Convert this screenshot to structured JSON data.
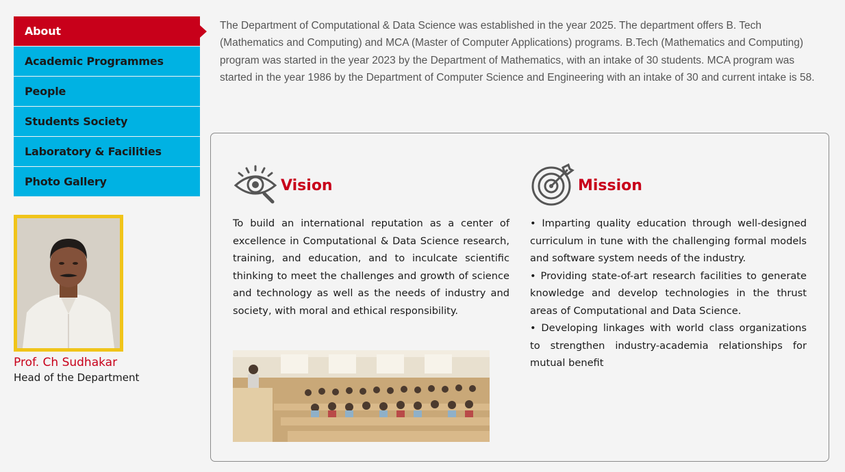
{
  "sidebar": {
    "items": [
      {
        "label": "About",
        "active": true
      },
      {
        "label": "Academic Programmes",
        "active": false
      },
      {
        "label": "People",
        "active": false
      },
      {
        "label": "Students Society",
        "active": false
      },
      {
        "label": "Laboratory & Facilities",
        "active": false
      },
      {
        "label": "Photo Gallery",
        "active": false
      }
    ]
  },
  "hod": {
    "name": "Prof. Ch Sudhakar",
    "title": "Head of the Department"
  },
  "intro": {
    "text": "The Department of Computational & Data Science was established in the year 2025. The department offers B. Tech (Mathematics and Computing) and MCA (Master of Computer Applications) programs. B.Tech (Mathematics and Computing) program was started in the year 2023 by the Department of Mathematics, with an intake of 30 students. MCA program was started in the year 1986 by the Department of Computer Science and Engineering with an intake of 30 and current intake is 58."
  },
  "vision": {
    "heading": "Vision",
    "icon": "eye-icon",
    "text": "To build an international reputation as a center of excellence in Computational & Data Science research, training, and education, and to inculcate scientific thinking to meet the challenges and growth of science and technology as well as the needs of industry and society, with moral and ethical responsibility."
  },
  "mission": {
    "heading": "Mission",
    "icon": "target-icon",
    "points": [
      "• Imparting quality education through well-designed curriculum in tune with the challenging formal models and software system needs of the industry.",
      "• Providing state-of-art research facilities to generate knowledge and develop technologies in the thrust areas of Computational and Data Science.",
      "• Developing linkages with world class organizations to strengthen industry-academia relationships for mutual benefit"
    ]
  },
  "colors": {
    "accent_red": "#c8001a",
    "nav_blue": "#00b2e3",
    "photo_border": "#f0c419"
  }
}
